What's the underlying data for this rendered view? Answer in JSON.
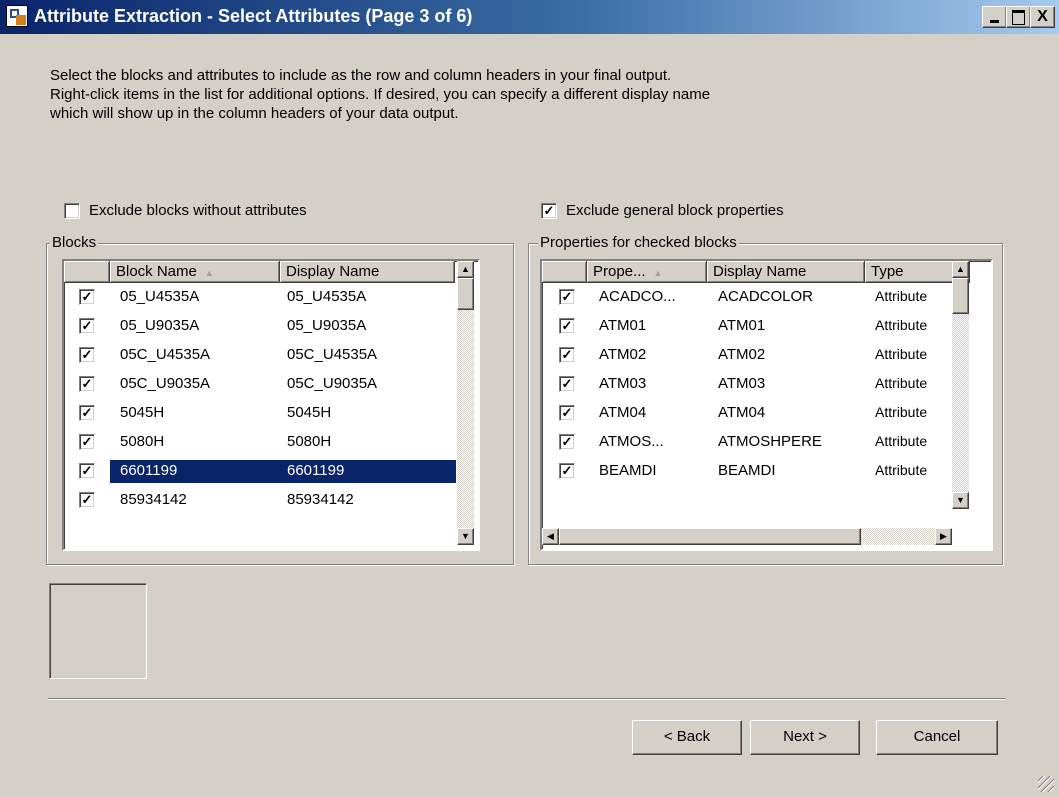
{
  "window": {
    "title": "Attribute Extraction - Select Attributes (Page 3 of 6)",
    "minimize_label": "_",
    "maximize_label": "□",
    "close_label": "X"
  },
  "description": [
    "Select the blocks and attributes to include as the row and column headers in your final output.",
    "Right-click items in the list for additional options. If desired, you can specify a different display name",
    "which will show up in the column headers of your data output."
  ],
  "options": {
    "exclude_without_attributes": {
      "label": "Exclude blocks without attributes",
      "checked": false
    },
    "exclude_general_properties": {
      "label": "Exclude general block properties",
      "checked": true
    }
  },
  "blocks": {
    "group_label": "Blocks",
    "columns": [
      "Block Name",
      "Display Name"
    ],
    "sort_indicator": "▲",
    "rows": [
      {
        "name": "05_U4535A",
        "display": "05_U4535A",
        "checked": true,
        "selected": false
      },
      {
        "name": "05_U9035A",
        "display": "05_U9035A",
        "checked": true,
        "selected": false
      },
      {
        "name": "05C_U4535A",
        "display": "05C_U4535A",
        "checked": true,
        "selected": false
      },
      {
        "name": "05C_U9035A",
        "display": "05C_U9035A",
        "checked": true,
        "selected": false
      },
      {
        "name": "5045H",
        "display": "5045H",
        "checked": true,
        "selected": false
      },
      {
        "name": "5080H",
        "display": "5080H",
        "checked": true,
        "selected": false
      },
      {
        "name": "6601199",
        "display": "6601199",
        "checked": true,
        "selected": true
      },
      {
        "name": "85934142",
        "display": "85934142",
        "checked": true,
        "selected": false
      }
    ]
  },
  "properties": {
    "group_label": "Properties for checked blocks",
    "columns": [
      "Prope...",
      "Display Name",
      "Type"
    ],
    "sort_indicator": "▲",
    "rows": [
      {
        "property": "ACADCO...",
        "display": "ACADCOLOR",
        "type": "Attribute",
        "checked": true
      },
      {
        "property": "ATM01",
        "display": "ATM01",
        "type": "Attribute",
        "checked": true
      },
      {
        "property": "ATM02",
        "display": "ATM02",
        "type": "Attribute",
        "checked": true
      },
      {
        "property": "ATM03",
        "display": "ATM03",
        "type": "Attribute",
        "checked": true
      },
      {
        "property": "ATM04",
        "display": "ATM04",
        "type": "Attribute",
        "checked": true
      },
      {
        "property": "ATMOS...",
        "display": "ATMOSHPERE",
        "type": "Attribute",
        "checked": true
      },
      {
        "property": "BEAMDI",
        "display": "BEAMDI",
        "type": "Attribute",
        "checked": true
      }
    ]
  },
  "buttons": {
    "back": "< Back",
    "next": "Next >",
    "cancel": "Cancel"
  },
  "glyphs": {
    "check": "✓",
    "scroll_up": "▲",
    "scroll_down": "▼",
    "scroll_left": "◀",
    "scroll_right": "▶"
  },
  "colors": {
    "face": "#d4d0c8",
    "title_start": "#0a246a",
    "title_end": "#a6caf0",
    "selection": "#0a246a"
  }
}
